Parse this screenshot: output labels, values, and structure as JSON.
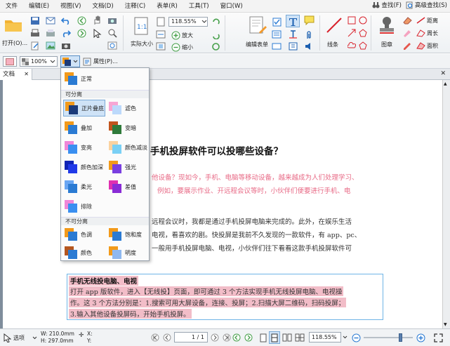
{
  "menu": {
    "items": [
      "文件",
      "编辑(E)",
      "视图(V)",
      "文档(D)",
      "注释(C)",
      "表单(R)",
      "工具(T)",
      "窗口(W)"
    ],
    "right": [
      "查找(F)",
      "高级查找(S)"
    ]
  },
  "ribbon": {
    "zoom_value": "118.55%",
    "labels": {
      "open": "打开(O)...",
      "actual_size": "实际大小",
      "zoom_in": "放大",
      "zoom_out": "缩小",
      "edit_form": "编辑表单",
      "line": "线条",
      "stamp": "图章",
      "distance": "距离",
      "perimeter": "周长",
      "area": "面积"
    }
  },
  "toolbar2": {
    "opacity": "100%",
    "properties": "属性(P)..."
  },
  "tabs": {
    "doc": "文档"
  },
  "blend_menu": {
    "normal": "正常",
    "separable_header": "可分离",
    "separable": [
      [
        "正片叠底",
        "滤色"
      ],
      [
        "叠加",
        "变暗"
      ],
      [
        "变亮",
        "颜色减淡"
      ],
      [
        "颜色加深",
        "强光"
      ],
      [
        "柔光",
        "差值"
      ],
      [
        "排除",
        ""
      ]
    ],
    "nonseparable_header": "不可分离",
    "nonseparable": [
      [
        "色调",
        "饱和度"
      ],
      [
        "颜色",
        "明度"
      ]
    ]
  },
  "doc": {
    "title": "手机投屏软件可以投哪些设备？",
    "pink1": "他设备？现如今，手机、电脑等移动设备，越来越成为人们处理学习、",
    "pink2": "例如，要展示作业、开远程会议等时，小伙伴们便要进行手机、电",
    "p1": "远程会议时，我都是通过手机投屏电脑来完成的。此外，在娱乐生活",
    "p2": "电视，看喜欢的剧。快投屏是我前不久发现的一款软件，有 app、pc、",
    "p3": "一般用手机投屏电脑、电视，小伙伴们往下看看这款手机投屏软件可",
    "box_title": "手机无线投电脑、电视",
    "box1": "打开 app 版软件，进入【无线投】页面，即可通过 3 个方法实现手机无线投屏电脑、电视操",
    "box2": "作。这 3 个方法分别是：1.搜索可用大屏设备，连接、投屏；2.扫描大屏二维码，扫码投屏；",
    "box3": "3.输入其他设备投屏码，开始手机投屏。"
  },
  "status": {
    "select": "选项",
    "w": "W: 210.0mm",
    "h": "H: 297.0mm",
    "x": "X:",
    "y": "Y:",
    "page": "1 / 1",
    "zoom": "118.55%"
  },
  "colors": {
    "accent": "#2b7bd3",
    "pink_text": "#e86a86",
    "highlight": "#f2bdc8",
    "box_border": "#6fb4e6"
  }
}
